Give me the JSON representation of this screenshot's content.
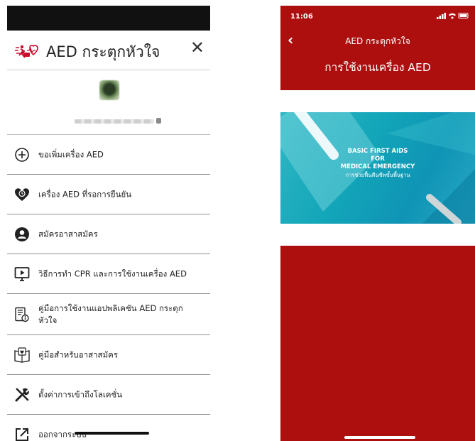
{
  "drawer": {
    "title": "AED กระตุกหัวใจ",
    "close_icon": "close-icon",
    "menu": [
      {
        "label": "ขอเพิ่มเครื่อง AED",
        "icon": "plus-circle-icon"
      },
      {
        "label": "เครื่อง AED ที่รอการยืนยัน",
        "icon": "heart-clock-icon"
      },
      {
        "label": "สมัครอาสาสมัคร",
        "icon": "user-circle-icon"
      },
      {
        "label": "วิธีการทำ CPR และการใช้งานเครื่อง AED",
        "icon": "play-screen-icon"
      },
      {
        "label": "คู่มือการใช้งานแอปพลิเคชัน AED กระตุกหัวใจ",
        "icon": "manual-info-icon"
      },
      {
        "label": "คู่มือสำหรับอาสาสมัคร",
        "icon": "volunteer-book-icon"
      },
      {
        "label": "ตั้งค่าการเข้าถึงโลเคชั่น",
        "icon": "tools-icon"
      },
      {
        "label": "ออกจากระบบ",
        "icon": "external-link-icon"
      }
    ]
  },
  "detail": {
    "status_time": "11:06",
    "nav_title": "AED กระตุกหัวใจ",
    "page_title": "การใช้งานเครื่อง AED",
    "banner": {
      "line1": "BASIC FIRST AIDS",
      "line2": "FOR",
      "line3": "MEDICAL EMERGENCY",
      "line4": "การช่วยฟื้นคืนชีพขั้นพื้นฐาน"
    }
  },
  "colors": {
    "brand_red": "#ad0f0f",
    "banner_teal": "#13a6b9"
  }
}
